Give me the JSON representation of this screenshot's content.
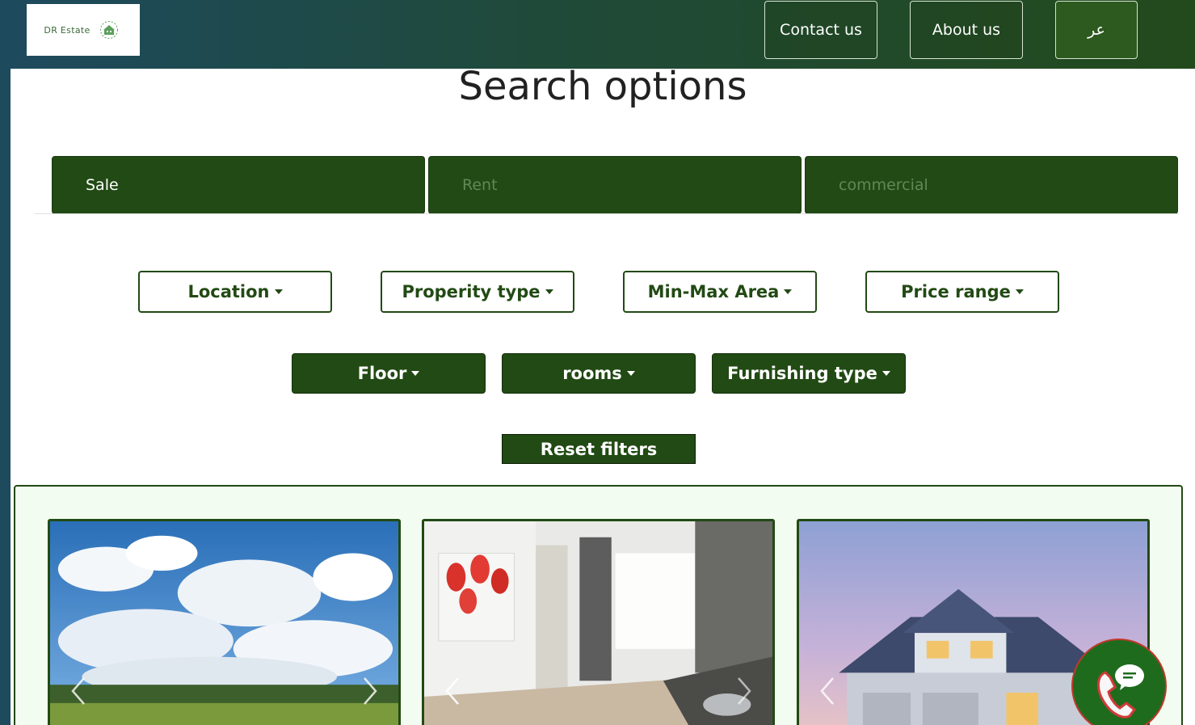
{
  "header": {
    "logo_text": "DR Estate",
    "nav": {
      "contact": "Contact us",
      "about": "About us",
      "language": "عر"
    }
  },
  "search": {
    "title": "Search options",
    "tabs": [
      "Sale",
      "Rent",
      "commercial"
    ],
    "active_tab": "Sale",
    "filters_row1": [
      "Location",
      "Properity type",
      "Min-Max Area",
      "Price range"
    ],
    "filters_row2": [
      "Floor",
      "rooms",
      "Furnishing type"
    ],
    "reset_label": "Reset filters"
  },
  "listings": {
    "cards": [
      {
        "image": "landscape-clouds-photo"
      },
      {
        "image": "apartment-interior-photo"
      },
      {
        "image": "house-exterior-photo"
      }
    ]
  },
  "colors": {
    "primary_green": "#224a14",
    "panel_bg": "#ffffff",
    "results_bg": "#f3fcf1",
    "chat_button": "#1f6b1e"
  },
  "icons": {
    "chat_button": "phone-chat-icon",
    "carousel_prev": "chevron-left-icon",
    "carousel_next": "chevron-right-icon",
    "dropdown": "caret-down-icon"
  }
}
